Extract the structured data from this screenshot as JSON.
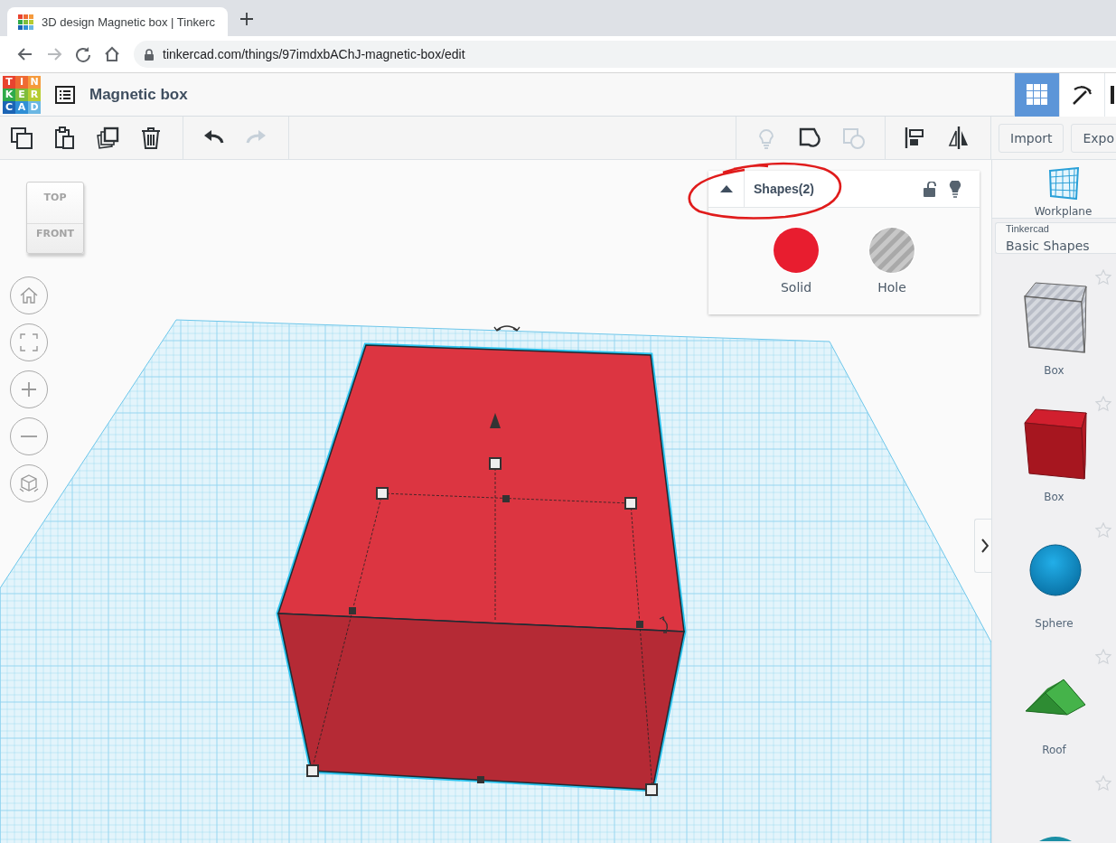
{
  "browser": {
    "tab_title": "3D design Magnetic box | Tinkerc",
    "url": "tinkercad.com/things/97imdxbAChJ-magnetic-box/edit",
    "nav": [
      {
        "kind": "back",
        "disabled": false
      },
      {
        "kind": "forward",
        "disabled": true
      },
      {
        "kind": "reload",
        "disabled": false
      },
      {
        "kind": "home",
        "disabled": false
      }
    ]
  },
  "app": {
    "logo": [
      {
        "letter": "T",
        "color": "#e8432f"
      },
      {
        "letter": "I",
        "color": "#ef6a33"
      },
      {
        "letter": "N",
        "color": "#f59a3c"
      },
      {
        "letter": "K",
        "color": "#2faa4a"
      },
      {
        "letter": "E",
        "color": "#7ebd3c"
      },
      {
        "letter": "R",
        "color": "#b7cc32"
      },
      {
        "letter": "C",
        "color": "#1b64b5"
      },
      {
        "letter": "A",
        "color": "#2f8fd6"
      },
      {
        "letter": "D",
        "color": "#6bb7e3"
      }
    ],
    "title": "Magnetic box",
    "modes": [
      {
        "kind": "grid",
        "selected": true
      },
      {
        "kind": "pickaxe",
        "selected": false
      },
      {
        "kind": "partial",
        "selected": false
      }
    ]
  },
  "toolbar": {
    "left": [
      {
        "kind": "copy",
        "disabled": false
      },
      {
        "kind": "paste",
        "disabled": false
      },
      {
        "kind": "duplicate",
        "disabled": false
      },
      {
        "kind": "delete",
        "disabled": false
      }
    ],
    "history": [
      {
        "kind": "undo",
        "disabled": false
      },
      {
        "kind": "redo",
        "disabled": true
      }
    ],
    "right": [
      {
        "kind": "bulb",
        "disabled": true
      },
      {
        "kind": "group",
        "disabled": false
      },
      {
        "kind": "ungroup",
        "disabled": true
      }
    ],
    "arrange": [
      {
        "kind": "align",
        "disabled": false
      },
      {
        "kind": "mirror",
        "disabled": false
      }
    ],
    "buttons": [
      "Import",
      "Expo"
    ]
  },
  "workspace": {
    "view_cube": {
      "top": "TOP",
      "front": "FRONT"
    },
    "nav_buttons": [
      {
        "kind": "home"
      },
      {
        "kind": "fit"
      },
      {
        "kind": "zoom-in"
      },
      {
        "kind": "zoom-out"
      },
      {
        "kind": "ortho"
      }
    ],
    "inspector": {
      "title": "Shapes(2)",
      "options": [
        {
          "kind": "solid",
          "label": "Solid"
        },
        {
          "kind": "hole",
          "label": "Hole"
        }
      ]
    }
  },
  "sidebar": {
    "workplane": "Workplane",
    "library": {
      "source": "Tinkercad",
      "name": "Basic Shapes"
    },
    "shapes": [
      {
        "kind": "box-hole",
        "label": "Box"
      },
      {
        "kind": "box-solid",
        "label": "Box"
      },
      {
        "kind": "sphere",
        "label": "Sphere"
      },
      {
        "kind": "roof",
        "label": "Roof"
      },
      {
        "kind": "partial"
      }
    ]
  }
}
